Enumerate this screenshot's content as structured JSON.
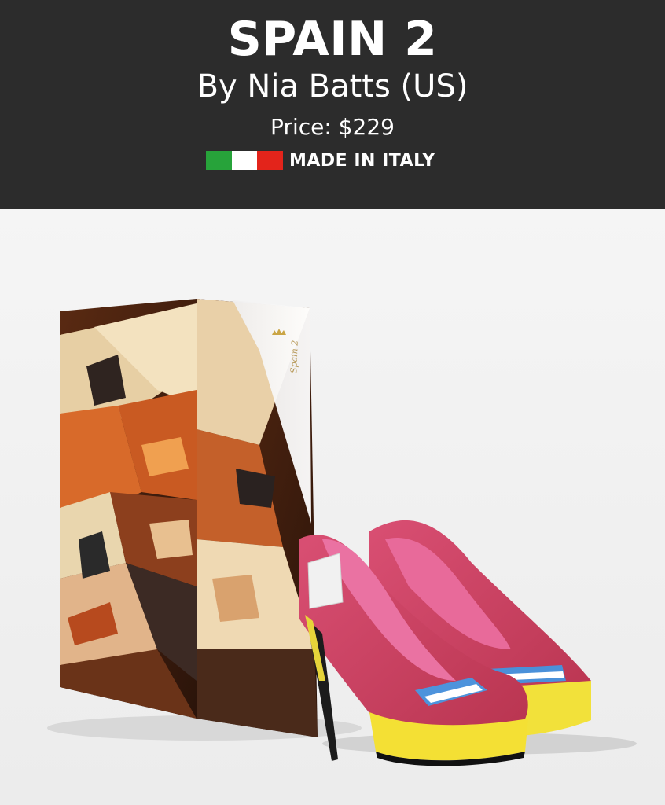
{
  "product": {
    "title": "SPAIN 2",
    "designer": "By Nia Batts (US)",
    "price": "Price: $229",
    "origin_label": "MADE IN ITALY",
    "flag_icon": "italy-flag-icon",
    "flag_colors": [
      "#27a33a",
      "#ffffff",
      "#e3241b"
    ]
  },
  "image": {
    "box_label": "Spain 2",
    "box_icon": "crown-icon"
  }
}
